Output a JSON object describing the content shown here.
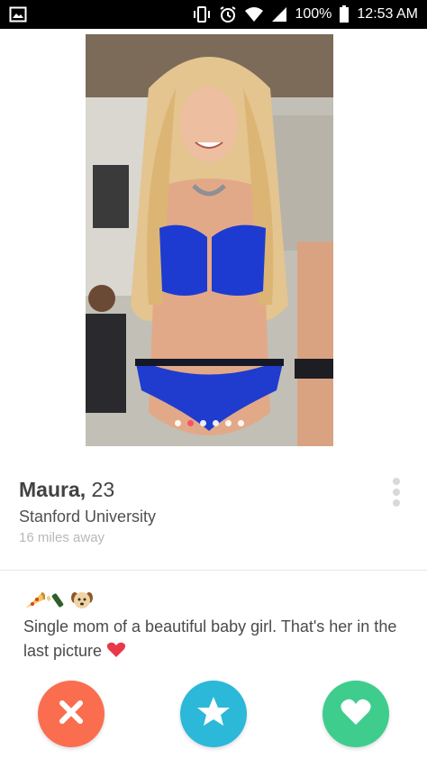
{
  "status_bar": {
    "battery": "100%",
    "time": "12:53 AM",
    "icons": [
      "image-notification-icon",
      "vibrate-icon",
      "alarm-icon",
      "wifi-icon",
      "signal-icon",
      "battery-icon"
    ]
  },
  "photo": {
    "alt": "profile-photo",
    "dot_count": 6,
    "active_dot_index": 1
  },
  "profile": {
    "name": "Maura,",
    "age": "23",
    "school": "Stanford University",
    "distance": "16 miles away"
  },
  "bio": {
    "emoji_icons": [
      "pizza-icon",
      "champagne-icon",
      "dog-icon"
    ],
    "text": "Single mom of a beautiful baby girl. That's her in the last picture",
    "trailing_icon": "heart-icon"
  },
  "actions": {
    "nope": "x-icon",
    "super_like": "star-icon",
    "like": "heart-icon"
  },
  "colors": {
    "nope": "#fa6e4f",
    "super_like": "#2bb8d9",
    "like": "#3ecd8d",
    "active_dot": "#fd5068"
  }
}
